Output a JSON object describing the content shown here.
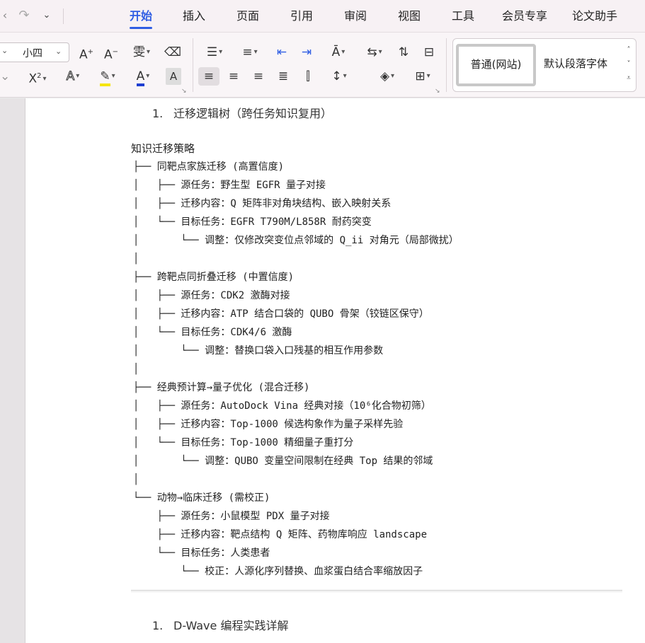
{
  "menu": {
    "tabs": [
      "开始",
      "插入",
      "页面",
      "引用",
      "审阅",
      "视图",
      "工具",
      "会员专享",
      "论文助手"
    ],
    "active_tab": "开始"
  },
  "ribbon": {
    "font_size": "小四",
    "style_gallery": {
      "selected_style": "普通(网站)",
      "next_style": "默认段落字体"
    },
    "icons": [
      "increase-font-size-icon",
      "decrease-font-size-icon",
      "phonetic-guide-icon",
      "clear-format-icon",
      "superscript-icon",
      "text-effect-icon",
      "highlight-icon",
      "font-color-icon",
      "character-shading-icon",
      "bullet-list-icon",
      "numbered-list-icon",
      "decrease-indent-icon",
      "increase-indent-icon",
      "text-direction-icon",
      "line-break-icon",
      "sort-icon",
      "show-marks-icon",
      "align-left-icon",
      "align-center-icon",
      "align-right-icon",
      "justify-icon",
      "distributed-icon",
      "line-spacing-icon",
      "shading-icon",
      "borders-icon"
    ],
    "colors": {
      "highlight": "#f5e50a",
      "font_color": "#1f3fd1",
      "accent": "#2f5de3"
    }
  },
  "document": {
    "heading1": {
      "number": "1.",
      "text": "迁移逻辑树（跨任务知识复用）"
    },
    "tree_title": "知识迁移策略",
    "tree": [
      "├── 同靶点家族迁移 (高置信度)",
      "│   ├── 源任务：野生型 EGFR 量子对接",
      "│   ├── 迁移内容：Q 矩阵非对角块结构、嵌入映射关系",
      "│   └── 目标任务：EGFR T790M/L858R 耐药突变",
      "│       └── 调整：仅修改突变位点邻域的 Q_ii 对角元（局部微扰）",
      "│",
      "├── 跨靶点同折叠迁移 (中置信度)",
      "│   ├── 源任务：CDK2 激酶对接",
      "│   ├── 迁移内容：ATP 结合口袋的 QUBO 骨架（铰链区保守）",
      "│   └── 目标任务：CDK4/6 激酶",
      "│       └── 调整：替换口袋入口残基的相互作用参数",
      "│",
      "├── 经典预计算→量子优化 (混合迁移)",
      "│   ├── 源任务：AutoDock Vina 经典对接（10⁶化合物初筛）",
      "│   ├── 迁移内容：Top-1000 候选构象作为量子采样先验",
      "│   └── 目标任务：Top-1000 精细量子重打分",
      "│       └── 调整：QUBO 变量空间限制在经典 Top 结果的邻域",
      "│",
      "└── 动物→临床迁移 (需校正)",
      "    ├── 源任务：小鼠模型 PDX 量子对接",
      "    ├── 迁移内容：靶点结构 Q 矩阵、药物库响应 landscape",
      "    └── 目标任务：人类患者",
      "        └── 校正：人源化序列替换、血浆蛋白结合率缩放因子"
    ],
    "heading2": {
      "number": "1.",
      "text": "D-Wave 编程实践详解"
    }
  }
}
